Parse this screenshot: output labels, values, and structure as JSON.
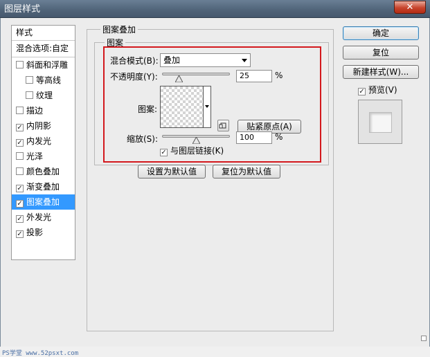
{
  "window": {
    "title": "图层样式",
    "close_label": "✕"
  },
  "sidebar": {
    "header": "样式",
    "blend_options": "混合选项:自定",
    "items": [
      {
        "label": "斜面和浮雕",
        "checked": false,
        "indent": false,
        "selected": false
      },
      {
        "label": "等高线",
        "checked": false,
        "indent": true,
        "selected": false
      },
      {
        "label": "纹理",
        "checked": false,
        "indent": true,
        "selected": false
      },
      {
        "label": "描边",
        "checked": false,
        "indent": false,
        "selected": false
      },
      {
        "label": "内阴影",
        "checked": true,
        "indent": false,
        "selected": false
      },
      {
        "label": "内发光",
        "checked": true,
        "indent": false,
        "selected": false
      },
      {
        "label": "光泽",
        "checked": false,
        "indent": false,
        "selected": false
      },
      {
        "label": "颜色叠加",
        "checked": false,
        "indent": false,
        "selected": false
      },
      {
        "label": "渐变叠加",
        "checked": true,
        "indent": false,
        "selected": false
      },
      {
        "label": "图案叠加",
        "checked": true,
        "indent": false,
        "selected": true
      },
      {
        "label": "外发光",
        "checked": true,
        "indent": false,
        "selected": false
      },
      {
        "label": "投影",
        "checked": true,
        "indent": false,
        "selected": false
      }
    ]
  },
  "panel": {
    "group_title": "图案叠加",
    "subgroup_title": "图案",
    "blend_mode_label": "混合模式(B):",
    "blend_mode_value": "叠加",
    "opacity_label": "不透明度(Y):",
    "opacity_value": "25",
    "opacity_fraction": 0.25,
    "percent": "%",
    "pattern_label": "图案:",
    "snap_origin_button": "贴紧原点(A)",
    "scale_label": "缩放(S):",
    "scale_value": "100",
    "scale_fraction": 0.5,
    "link_layer_label": "与图层链接(K)",
    "link_layer_checked": true,
    "make_default_button": "设置为默认值",
    "reset_default_button": "复位为默认值"
  },
  "actions": {
    "ok": "确定",
    "reset": "复位",
    "new_style": "新建样式(W)...",
    "preview_label": "预览(V)",
    "preview_checked": true
  },
  "watermark": "PS学堂 www.52psxt.com",
  "colors": {
    "selection": "#3399ff",
    "highlight_frame": "#d3181d",
    "titlebar": "#4f6378"
  }
}
